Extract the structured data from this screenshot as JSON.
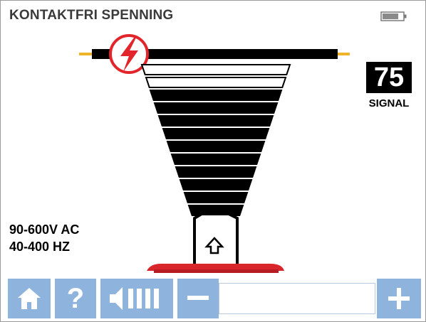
{
  "header": {
    "title": "KONTAKTFRI SPENNING",
    "battery_icon": "battery-icon"
  },
  "signal": {
    "value": "75",
    "label": "SIGNAL"
  },
  "specs": {
    "voltage": "90-600V AC",
    "frequency": "40-400 HZ"
  },
  "meter": {
    "total_bars": 12,
    "lit_bars": 10
  },
  "toolbar": {
    "home_icon": "home-icon",
    "help_label": "?",
    "volume_icon": "volume-icon",
    "minus_icon": "minus-icon",
    "plus_icon": "plus-icon"
  },
  "colors": {
    "button": "#8eb4dd",
    "warning_red": "#e2242b",
    "probe_base": "#d9262c",
    "wire_tip": "#f0b429"
  }
}
